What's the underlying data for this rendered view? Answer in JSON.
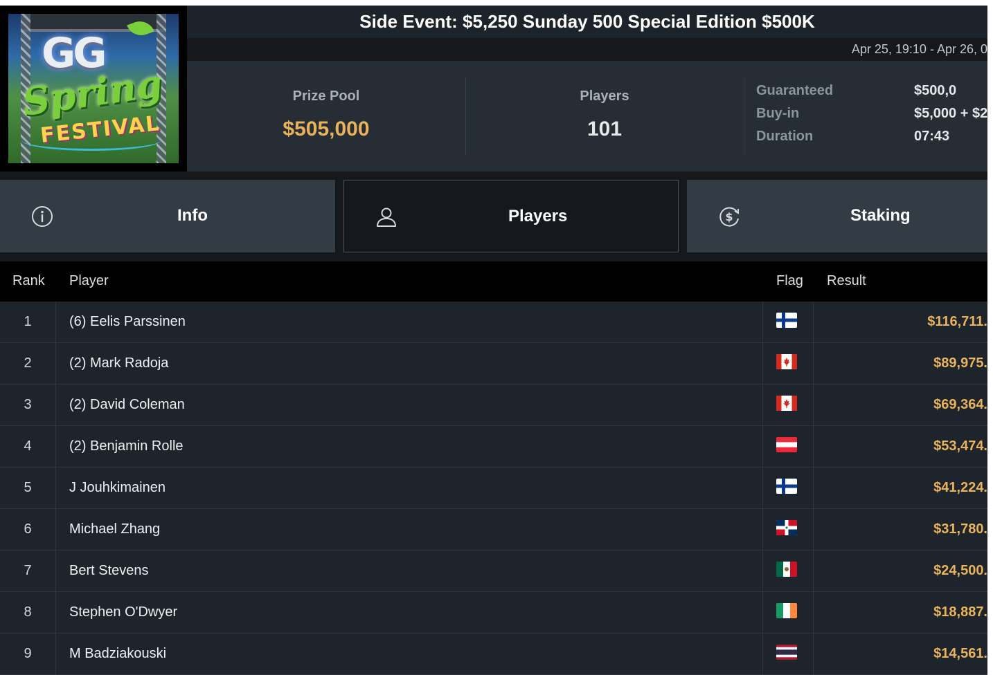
{
  "header": {
    "logo_text": {
      "line1": "GG",
      "line2": "Spring",
      "line3": "FESTIVAL"
    },
    "title": "Side Event: $5,250 Sunday 500 Special Edition $500K",
    "date_range": "Apr 25, 19:10 - Apr 26, 0"
  },
  "stats": {
    "prize_pool_label": "Prize Pool",
    "prize_pool_value": "$505,000",
    "players_label": "Players",
    "players_value": "101",
    "details": [
      {
        "label": "Guaranteed",
        "value": "$500,0"
      },
      {
        "label": "Buy-in",
        "value": "$5,000 + $2"
      },
      {
        "label": "Duration",
        "value": "07:43"
      }
    ]
  },
  "tabs": [
    {
      "label": "Info",
      "icon": "info-icon"
    },
    {
      "label": "Players",
      "icon": "user-icon",
      "active": true
    },
    {
      "label": "Staking",
      "icon": "dollar-cycle-icon"
    }
  ],
  "table": {
    "headers": {
      "rank": "Rank",
      "player": "Player",
      "flag": "Flag",
      "result": "Result"
    },
    "rows": [
      {
        "rank": "1",
        "player": "(6) Eelis Parssinen",
        "flag": "finland-flag",
        "result": "$116,711."
      },
      {
        "rank": "2",
        "player": "(2) Mark Radoja",
        "flag": "canada-flag",
        "result": "$89,975."
      },
      {
        "rank": "3",
        "player": "(2) David Coleman",
        "flag": "canada-flag",
        "result": "$69,364."
      },
      {
        "rank": "4",
        "player": "(2) Benjamin Rolle",
        "flag": "austria-flag",
        "result": "$53,474."
      },
      {
        "rank": "5",
        "player": "J Jouhkimainen",
        "flag": "finland-flag",
        "result": "$41,224."
      },
      {
        "rank": "6",
        "player": "Michael Zhang",
        "flag": "dominican-republic-flag",
        "result": "$31,780."
      },
      {
        "rank": "7",
        "player": "Bert Stevens",
        "flag": "mexico-flag",
        "result": "$24,500."
      },
      {
        "rank": "8",
        "player": "Stephen O'Dwyer",
        "flag": "ireland-flag",
        "result": "$18,887."
      },
      {
        "rank": "9",
        "player": "M Badziakouski",
        "flag": "thailand-flag",
        "result": "$14,561."
      }
    ]
  },
  "colors": {
    "accent_gold": "#e8b35a",
    "background": "#15191e",
    "panel": "#262d35",
    "tab_inactive": "#333b45",
    "table_header": "#000000"
  }
}
